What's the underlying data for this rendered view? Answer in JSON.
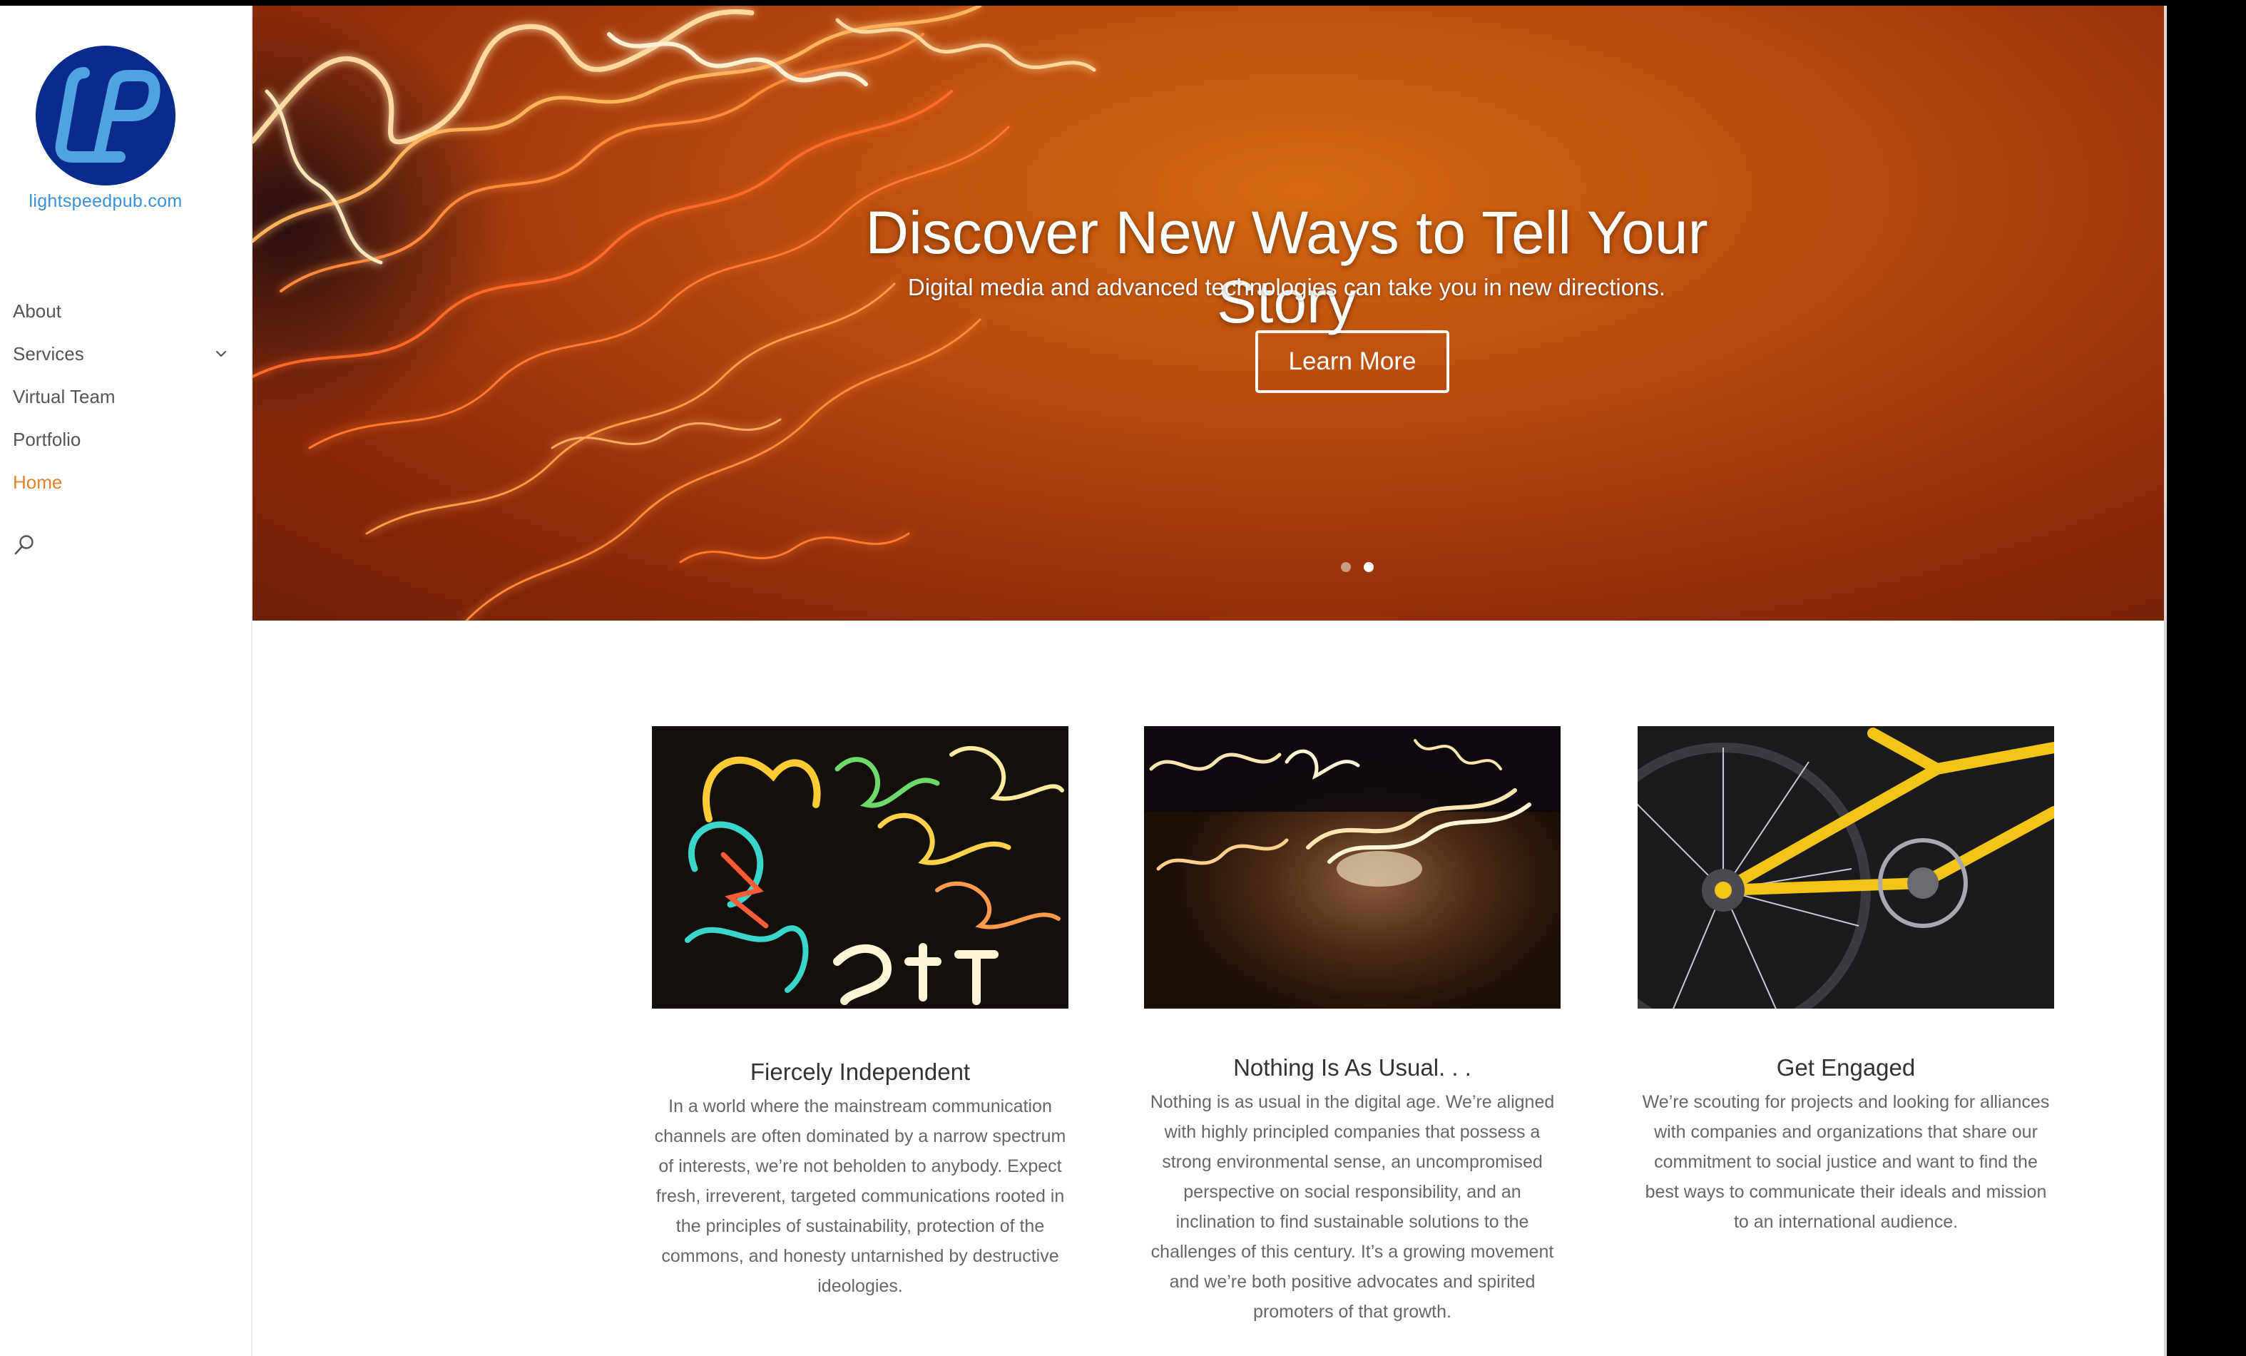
{
  "sidebar": {
    "logo_text": "lightspeedpub.com",
    "nav": [
      {
        "label": "About",
        "active": false
      },
      {
        "label": "Services",
        "active": false,
        "has_children": true
      },
      {
        "label": "Virtual Team",
        "active": false
      },
      {
        "label": "Portfolio",
        "active": false
      },
      {
        "label": "Home",
        "active": true
      }
    ],
    "search_icon": "search-icon"
  },
  "hero": {
    "title": "Discover New Ways to Tell Your Story",
    "subtitle": "Digital media and advanced technologies can take you in new directions.",
    "button_label": "Learn More",
    "slide_count": 2,
    "active_slide": 2
  },
  "features": [
    {
      "title": "Fiercely Independent",
      "text": "In a world where the mainstream communication channels are often dominated by a narrow spectrum of interests, we’re not beholden to anybody. Expect fresh, irreverent, targeted communications rooted in the principles of sustainability, protection of the commons, and honesty untarnished by destructive ideologies."
    },
    {
      "title": "Nothing Is As Usual. . .",
      "text": "Nothing is as usual in the digital age. We’re aligned with highly principled companies that possess a strong environmental sense, an uncompromised perspective on social responsibility, and an inclination to find sustainable solutions to the challenges of this century. It’s a growing movement and we’re both positive advocates and spirited promoters of that growth."
    },
    {
      "title": "Get Engaged",
      "text": "We’re scouting for projects and looking for alliances with companies and organizations that share our commitment to social justice and want to find the best ways to communicate their ideals and mission to an international audience."
    }
  ],
  "colors": {
    "accent": "#e0832b",
    "logo_blue": "#3b8fd6",
    "logo_navy": "#0a2a8c",
    "hero_orange": "#b84b0e"
  }
}
